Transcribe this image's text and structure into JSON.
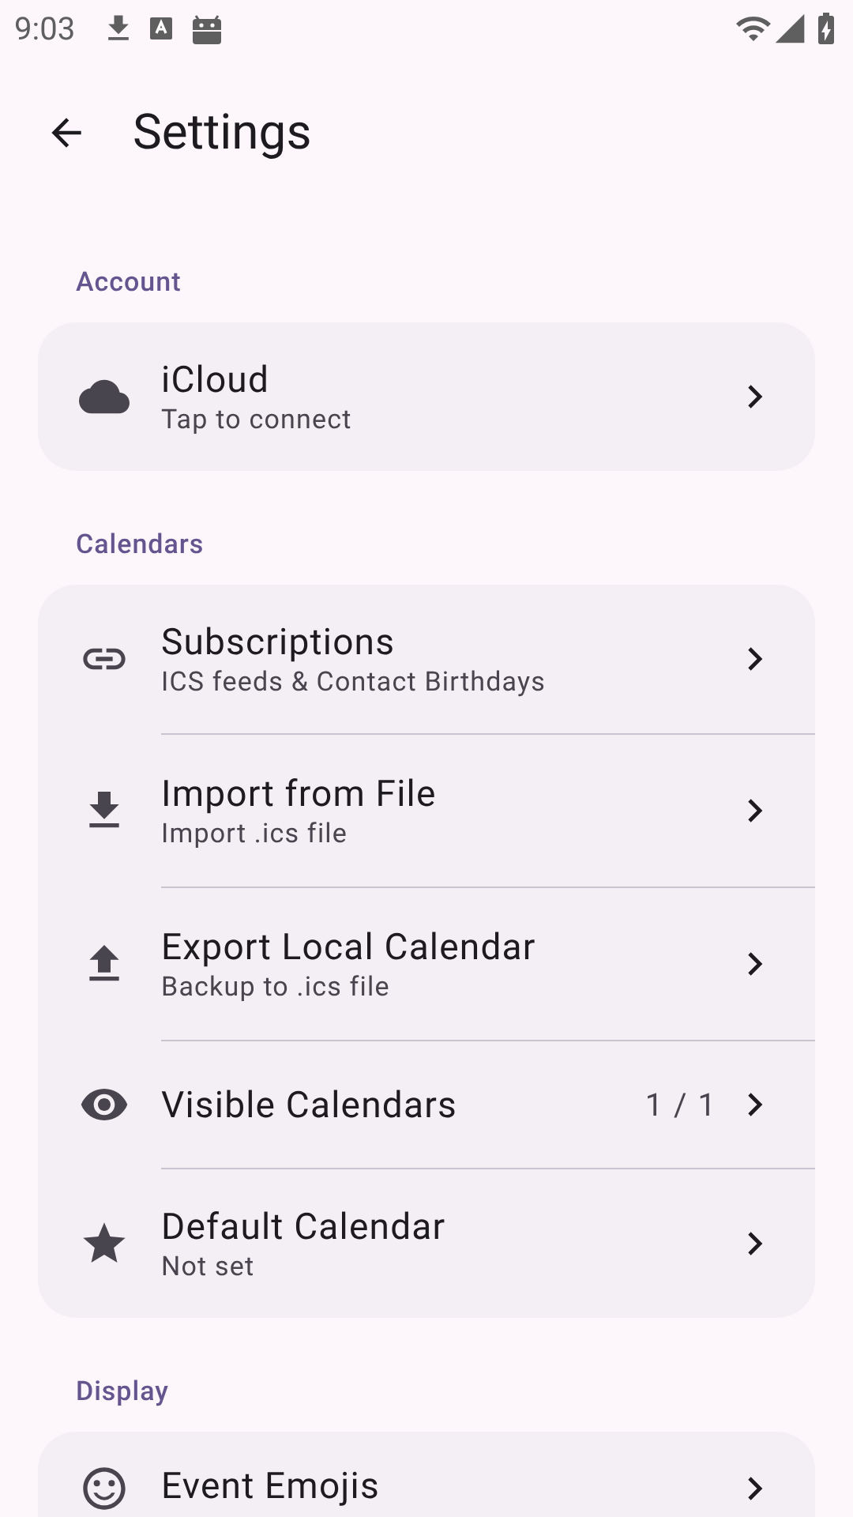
{
  "status_bar": {
    "time": "9:03"
  },
  "header": {
    "title": "Settings"
  },
  "sections": [
    {
      "label": "Account",
      "items": [
        {
          "title": "iCloud",
          "subtitle": "Tap to connect"
        }
      ]
    },
    {
      "label": "Calendars",
      "items": [
        {
          "title": "Subscriptions",
          "subtitle": "ICS feeds & Contact Birthdays"
        },
        {
          "title": "Import from File",
          "subtitle": "Import .ics file"
        },
        {
          "title": "Export Local Calendar",
          "subtitle": "Backup to .ics file"
        },
        {
          "title": "Visible Calendars",
          "value": "1 / 1"
        },
        {
          "title": "Default Calendar",
          "subtitle": "Not set"
        }
      ]
    },
    {
      "label": "Display",
      "items": [
        {
          "title": "Event Emojis"
        }
      ]
    }
  ]
}
